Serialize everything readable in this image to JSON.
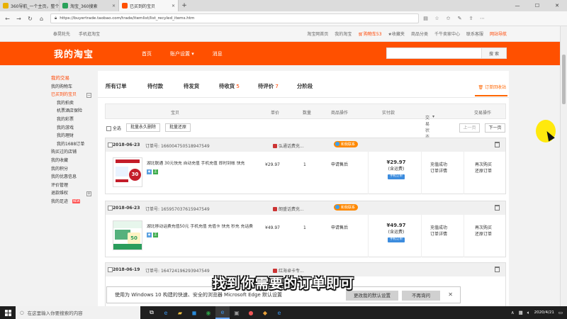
{
  "browser": {
    "tabs": [
      {
        "label": "360导航_一个主页，整个世",
        "icon_color": "#e8b000",
        "active": false
      },
      {
        "label": "淘宝_360搜索",
        "icon_color": "#2aa25a",
        "active": false
      },
      {
        "label": "已买到的宝贝",
        "icon_color": "#ff5000",
        "active": true
      }
    ],
    "url": "https://buyertrade.taobao.com/trade/itemlist/list_recyled_items.htm"
  },
  "topbar": {
    "left": [
      "泰晃轮先",
      "手机逛淘宝"
    ],
    "right": [
      "淘宝网首页",
      "我的淘宝",
      "购物车",
      "收藏夹",
      "商品分类",
      "千牛卖家中心",
      "联系客服",
      "网站导航"
    ],
    "cart_count": "53"
  },
  "header": {
    "logo": "我的淘宝",
    "nav": [
      "首页",
      "账户设置",
      "消息"
    ],
    "search_button": "搜 索",
    "search_placeholder": ""
  },
  "sidebar": {
    "items": [
      {
        "label": "我的交易",
        "kind": "head"
      },
      {
        "label": "我的购物车",
        "kind": "item"
      },
      {
        "label": "已买到的宝贝",
        "kind": "active",
        "plus": true
      },
      {
        "label": "我的拍卖",
        "kind": "sub"
      },
      {
        "label": "机票酒店保险",
        "kind": "sub"
      },
      {
        "label": "我的彩票",
        "kind": "sub"
      },
      {
        "label": "我的游戏",
        "kind": "sub"
      },
      {
        "label": "我的理财",
        "kind": "sub"
      },
      {
        "label": "我的1688订单",
        "kind": "sub"
      },
      {
        "label": "购买过的店铺",
        "kind": "item"
      },
      {
        "label": "我的收藏",
        "kind": "item"
      },
      {
        "label": "我的积分",
        "kind": "item"
      },
      {
        "label": "我的优惠信息",
        "kind": "item"
      },
      {
        "label": "评价管理",
        "kind": "item"
      },
      {
        "label": "退款维权",
        "kind": "item",
        "plus": true
      },
      {
        "label": "我的足迹",
        "kind": "item",
        "badge": "NEW"
      }
    ]
  },
  "order_tabs": {
    "tabs": [
      {
        "label": "所有订单",
        "count": ""
      },
      {
        "label": "待付款",
        "count": ""
      },
      {
        "label": "待发货",
        "count": ""
      },
      {
        "label": "待收货",
        "count": "5"
      },
      {
        "label": "待评价",
        "count": "7"
      },
      {
        "label": "分阶段",
        "count": ""
      }
    ],
    "recycle_label": "订单回收站"
  },
  "table_header": {
    "columns": [
      "宝贝",
      "单价",
      "数量",
      "商品操作",
      "实付款",
      "交易状态",
      "交易操作"
    ]
  },
  "bulk": {
    "select_all": "全选",
    "delete_forever": "批量永久删除",
    "restore": "批量还原",
    "prev": "上一页",
    "next": "下一页"
  },
  "orders": [
    {
      "date": "2018-06-23",
      "order_label": "订单号:",
      "order_no": "166004750518947549",
      "shop": "弘通话费充...",
      "contact": "和我联系",
      "title": "湖北联通 30元快充 自动充值 手机充值 即时到帐 快充",
      "thumb_text": "30",
      "thumb_color": "#c41d2a",
      "unit_price": "¥29.97",
      "qty": "1",
      "item_op": "申请售后",
      "paid": "¥29.97",
      "paid_note": "(含运费)",
      "paid_tag": "手机订单",
      "status": [
        "充值成功",
        "订单详情"
      ],
      "ops": [
        "再次购买",
        "还原订单"
      ]
    },
    {
      "date": "2018-06-23",
      "order_label": "订单号:",
      "order_no": "165957037615947549",
      "shop": "朗盛话费充...",
      "contact": "和我联系",
      "title": "湖北移动话费充值50元 手机充值 充值卡 快充 秒充 充话费",
      "thumb_text": "50",
      "thumb_color": "#2a9d5c",
      "unit_price": "¥49.97",
      "qty": "1",
      "item_op": "申请售后",
      "paid": "¥49.97",
      "paid_note": "(含运费)",
      "paid_tag": "手机订单",
      "status": [
        "充值成功",
        "订单详情"
      ],
      "ops": [
        "再次购买",
        "还原订单"
      ]
    },
    {
      "date": "2018-06-19",
      "order_label": "订单号:",
      "order_no": "164724196293947549",
      "shop": "红海卓卡专..."
    }
  ],
  "notification": {
    "text": "使用为 Windows 10 构建的快速、安全的浏览器 Microsoft Edge 默认设置",
    "primary": "更改我的默认设置",
    "secondary": "不再询问"
  },
  "subtitle": "找到你需要的订单即可",
  "taskbar": {
    "search_placeholder": "在这里输入你要搜索的内容",
    "time": "10:??",
    "date": "2020/4/21"
  }
}
